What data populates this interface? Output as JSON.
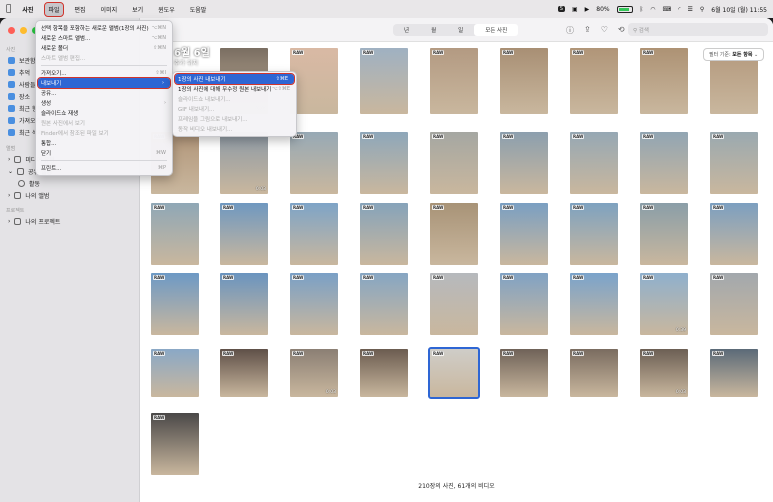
{
  "menubar": {
    "app": "사진",
    "items": [
      "파일",
      "편집",
      "이미지",
      "보기",
      "윈도우",
      "도움말"
    ],
    "active_index": 0,
    "status_badge": "S",
    "battery_text": "80%",
    "battery_level": 0.8,
    "datetime": "6월 10일 (월) 11:55"
  },
  "sidebar": {
    "section_library": "사진",
    "library_items": [
      "보관함",
      "추억",
      "사람들",
      "장소",
      "최근 항목",
      "가져오기",
      "최근 삭제된 항목"
    ],
    "section_albums": "앨범",
    "album_items": [
      "미디어 유형",
      "공유 앨범",
      "활동",
      "나의 앨범"
    ],
    "section_projects": "프로젝트",
    "project_items": [
      "나의 프로젝트"
    ]
  },
  "toolbar": {
    "segments": [
      "년",
      "월",
      "일",
      "모든 사진"
    ],
    "selected_segment": 3,
    "search_placeholder": "검색"
  },
  "filter": {
    "label": "필터 기준:",
    "value": "모든 항목"
  },
  "date_header": {
    "title": "6월 6일",
    "subtitle": "추가 위치"
  },
  "footer": {
    "count": "210장의 사진, 61개의 비디오"
  },
  "file_menu": {
    "items": [
      {
        "label": "선택 항목을 포함하는 새로운 앨범(1장의 사진)",
        "shortcut": "⌥⌘N",
        "disabled": false
      },
      {
        "label": "새로운 스마트 앨범...",
        "shortcut": "⌥⌘N",
        "disabled": false
      },
      {
        "label": "새로운 폴더",
        "shortcut": "⇧⌘N",
        "disabled": false
      },
      {
        "label": "스마트 앨범 편집...",
        "shortcut": "",
        "disabled": true
      },
      {
        "sep": true
      },
      {
        "label": "가져오기...",
        "shortcut": "⇧⌘I",
        "disabled": false
      },
      {
        "label": "내보내기",
        "shortcut": "›",
        "disabled": false,
        "highlight": true
      },
      {
        "label": "공유...",
        "shortcut": "",
        "disabled": false
      },
      {
        "label": "생성",
        "shortcut": "›",
        "disabled": false
      },
      {
        "label": "슬라이드쇼 재생",
        "shortcut": "",
        "disabled": false
      },
      {
        "label": "원본 사진에서 보기",
        "shortcut": "",
        "disabled": true
      },
      {
        "label": "Finder에서 참조된 파일 보기",
        "shortcut": "",
        "disabled": true
      },
      {
        "label": "통합...",
        "shortcut": "",
        "disabled": false
      },
      {
        "label": "닫기",
        "shortcut": "⌘W",
        "disabled": false
      },
      {
        "sep": true
      },
      {
        "label": "프린트...",
        "shortcut": "⌘P",
        "disabled": false
      }
    ]
  },
  "export_menu": {
    "items": [
      {
        "label": "1장의 사진 내보내기",
        "shortcut": "⇧⌘E",
        "disabled": false,
        "highlight": true
      },
      {
        "label": "1장의 사진에 대해 무수정 원본 내보내기",
        "shortcut": "⌥⇧⌘E",
        "disabled": false
      },
      {
        "label": "슬라이드쇼 내보내기...",
        "shortcut": "",
        "disabled": true
      },
      {
        "label": "GIF 내보내기...",
        "shortcut": "",
        "disabled": true
      },
      {
        "label": "프레임을 그림으로 내보내기...",
        "shortcut": "",
        "disabled": true
      },
      {
        "label": "동작 비디오 내보내기...",
        "shortcut": "",
        "disabled": true
      }
    ]
  },
  "thumbs": [
    {
      "raw": false,
      "dur": "0:03",
      "c": "#7a6e62"
    },
    {
      "raw": true,
      "dur": "",
      "c": "#d9b9a4"
    },
    {
      "raw": true,
      "dur": "",
      "c": "#9fb1c2"
    },
    {
      "raw": true,
      "dur": "",
      "c": "#b39a82"
    },
    {
      "raw": true,
      "dur": "",
      "c": "#a88f74"
    },
    {
      "raw": true,
      "dur": "",
      "c": "#b09578"
    },
    {
      "raw": true,
      "dur": "",
      "c": "#ad9274"
    },
    {
      "raw": true,
      "dur": "",
      "c": "#b3987c"
    },
    {
      "raw": true,
      "dur": "",
      "c": "#b19579"
    },
    {
      "raw": false,
      "dur": "0:03",
      "c": "#8d9aa6"
    },
    {
      "raw": true,
      "dur": "",
      "c": "#97a9b5"
    },
    {
      "raw": true,
      "dur": "",
      "c": "#8ea7ba"
    },
    {
      "raw": true,
      "dur": "",
      "c": "#a5a7a2"
    },
    {
      "raw": true,
      "dur": "",
      "c": "#8c9fae"
    },
    {
      "raw": true,
      "dur": "",
      "c": "#96a8b4"
    },
    {
      "raw": true,
      "dur": "",
      "c": "#91a5b3"
    },
    {
      "raw": true,
      "dur": "",
      "c": "#9aa9b0"
    },
    {
      "raw": true,
      "dur": "",
      "c": "#8fa7b6"
    },
    {
      "raw": true,
      "dur": "",
      "c": "#6f98c0"
    },
    {
      "raw": true,
      "dur": "",
      "c": "#7ea4c7"
    },
    {
      "raw": true,
      "dur": "",
      "c": "#86a3ba"
    },
    {
      "raw": true,
      "dur": "",
      "c": "#a89377"
    },
    {
      "raw": true,
      "dur": "",
      "c": "#7a9fc2"
    },
    {
      "raw": true,
      "dur": "",
      "c": "#7ea2c0"
    },
    {
      "raw": true,
      "dur": "",
      "c": "#8a9ea8"
    },
    {
      "raw": true,
      "dur": "",
      "c": "#7c9fc0"
    },
    {
      "raw": true,
      "dur": "",
      "c": "#6d99c5"
    },
    {
      "raw": true,
      "dur": "",
      "c": "#6a94bf"
    },
    {
      "raw": true,
      "dur": "",
      "c": "#7aa0c6"
    },
    {
      "raw": true,
      "dur": "",
      "c": "#86a6c3"
    },
    {
      "raw": true,
      "dur": "",
      "c": "#b6b9bd"
    },
    {
      "raw": true,
      "dur": "",
      "c": "#80a2c4"
    },
    {
      "raw": true,
      "dur": "",
      "c": "#7aa3cb"
    },
    {
      "raw": true,
      "dur": "0:39",
      "c": "#8fb0cd"
    },
    {
      "raw": true,
      "dur": "",
      "c": "#a2a8ad"
    },
    {
      "raw": true,
      "dur": "",
      "c": "#8aa8c6"
    },
    {
      "raw": true,
      "dur": "",
      "c": "#5f5048"
    },
    {
      "raw": true,
      "dur": "0:03",
      "c": "#8b7f74"
    },
    {
      "raw": true,
      "dur": "",
      "c": "#6b5c50"
    },
    {
      "raw": true,
      "dur": "",
      "c": "#cfcdc8"
    },
    {
      "raw": true,
      "dur": "",
      "c": "#6f6258"
    },
    {
      "raw": true,
      "dur": "",
      "c": "#7a6c60"
    },
    {
      "raw": true,
      "dur": "0:03",
      "c": "#6c5f54"
    },
    {
      "raw": true,
      "dur": "",
      "c": "#5b6a78"
    },
    {
      "raw": true,
      "dur": "",
      "c": "#4a4848"
    },
    {
      "raw": true,
      "dur": "",
      "c": "#7fa7cc"
    }
  ]
}
